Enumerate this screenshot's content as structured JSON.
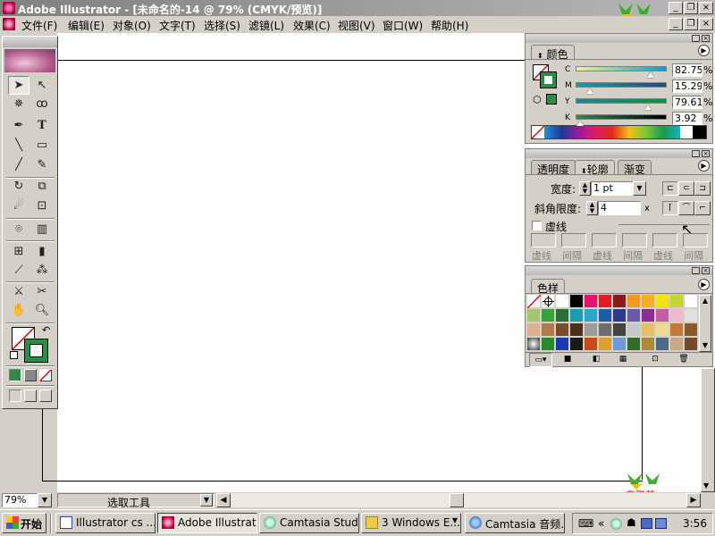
{
  "window": {
    "title": "Adobe Illustrator - [未命名的-14 @ 79% (CMYK/预览)]"
  },
  "logo_text": "育碟苑",
  "menu": [
    {
      "label": "文件(F)"
    },
    {
      "label": "编辑(E)"
    },
    {
      "label": "对象(O)"
    },
    {
      "label": "文字(T)"
    },
    {
      "label": "选择(S)"
    },
    {
      "label": "滤镜(L)"
    },
    {
      "label": "效果(C)"
    },
    {
      "label": "视图(V)"
    },
    {
      "label": "窗口(W)"
    },
    {
      "label": "帮助(H)"
    }
  ],
  "color_panel": {
    "tab": "颜色",
    "channels": [
      {
        "label": "C",
        "value": "82.75",
        "unit": "%",
        "fraction": 0.8275,
        "gradient": "#f2f29a,#00a0c8"
      },
      {
        "label": "M",
        "value": "15.29",
        "unit": "%",
        "fraction": 0.1529,
        "gradient": "#1a9bb0,#1b4f7a"
      },
      {
        "label": "Y",
        "value": "79.61",
        "unit": "%",
        "fraction": 0.7961,
        "gradient": "#2e7e9c,#1e8a3c"
      },
      {
        "label": "K",
        "value": "3.92",
        "unit": "%",
        "fraction": 0.0392,
        "gradient": "#2f8a52,#000000"
      }
    ],
    "current_color": "#2e8b45"
  },
  "stroke_panel": {
    "tabs": [
      {
        "label": "透明度"
      },
      {
        "label": "轮廓"
      },
      {
        "label": "渐变"
      }
    ],
    "weight_label": "宽度:",
    "weight_value": "1 pt",
    "miter_label": "斜角限度:",
    "miter_value": "4",
    "miter_unit": "x",
    "dashed_label": "虚线",
    "dash_fields": [
      {
        "label": "虚线"
      },
      {
        "label": "间隔"
      },
      {
        "label": "虚线"
      },
      {
        "label": "间隔"
      },
      {
        "label": "虚线"
      },
      {
        "label": "间隔"
      }
    ]
  },
  "swatch_panel": {
    "tab": "色样",
    "rows": [
      [
        "none",
        "reg",
        "#ffffff",
        "#000000",
        "#e8116e",
        "#e41b23",
        "#8b1a1a",
        "#f39a1e",
        "#f6b01b",
        "#f4e300",
        "#c6d530",
        "#ffffff"
      ],
      [
        "#a4c66e",
        "#3aa23b",
        "#2a6e3a",
        "#1b9db0",
        "#2aa5cc",
        "#1f5ca8",
        "#2b3a8e",
        "#6b5ba8",
        "#8a2f8e",
        "#c45ea2",
        "#f0b8d0",
        "#e0e0e0"
      ],
      [
        "#e0b08a",
        "#b07a4a",
        "#7a4a2a",
        "#4a2f1a",
        "#9c9c9c",
        "#6e6e6e",
        "#444444",
        "#c8c8c8",
        "#e6c066",
        "#f0d890",
        "#c07a3a",
        "#8a5a2a"
      ],
      [
        "grad-ray",
        "#2a8a2a",
        "#1a3ab0",
        "#1a1a1a",
        "#c84a1a",
        "#d8a030",
        "#6e9ad8",
        "#2a6e2a",
        "#b0883a",
        "#4a6a8a",
        "#c8a880",
        "#704a2a"
      ]
    ]
  },
  "status": {
    "zoom": "79%",
    "tool": "选取工具"
  },
  "taskbar": {
    "start": "开始",
    "buttons": [
      {
        "label": "Illustrator cs ...",
        "active": false
      },
      {
        "label": "Adobe Illustrat...",
        "active": true
      },
      {
        "label": "Camtasia Studi...",
        "active": false
      },
      {
        "label": "3 Windows E...",
        "active": false
      },
      {
        "label": "Camtasia 音频...",
        "active": false
      }
    ],
    "time": "3:56"
  }
}
